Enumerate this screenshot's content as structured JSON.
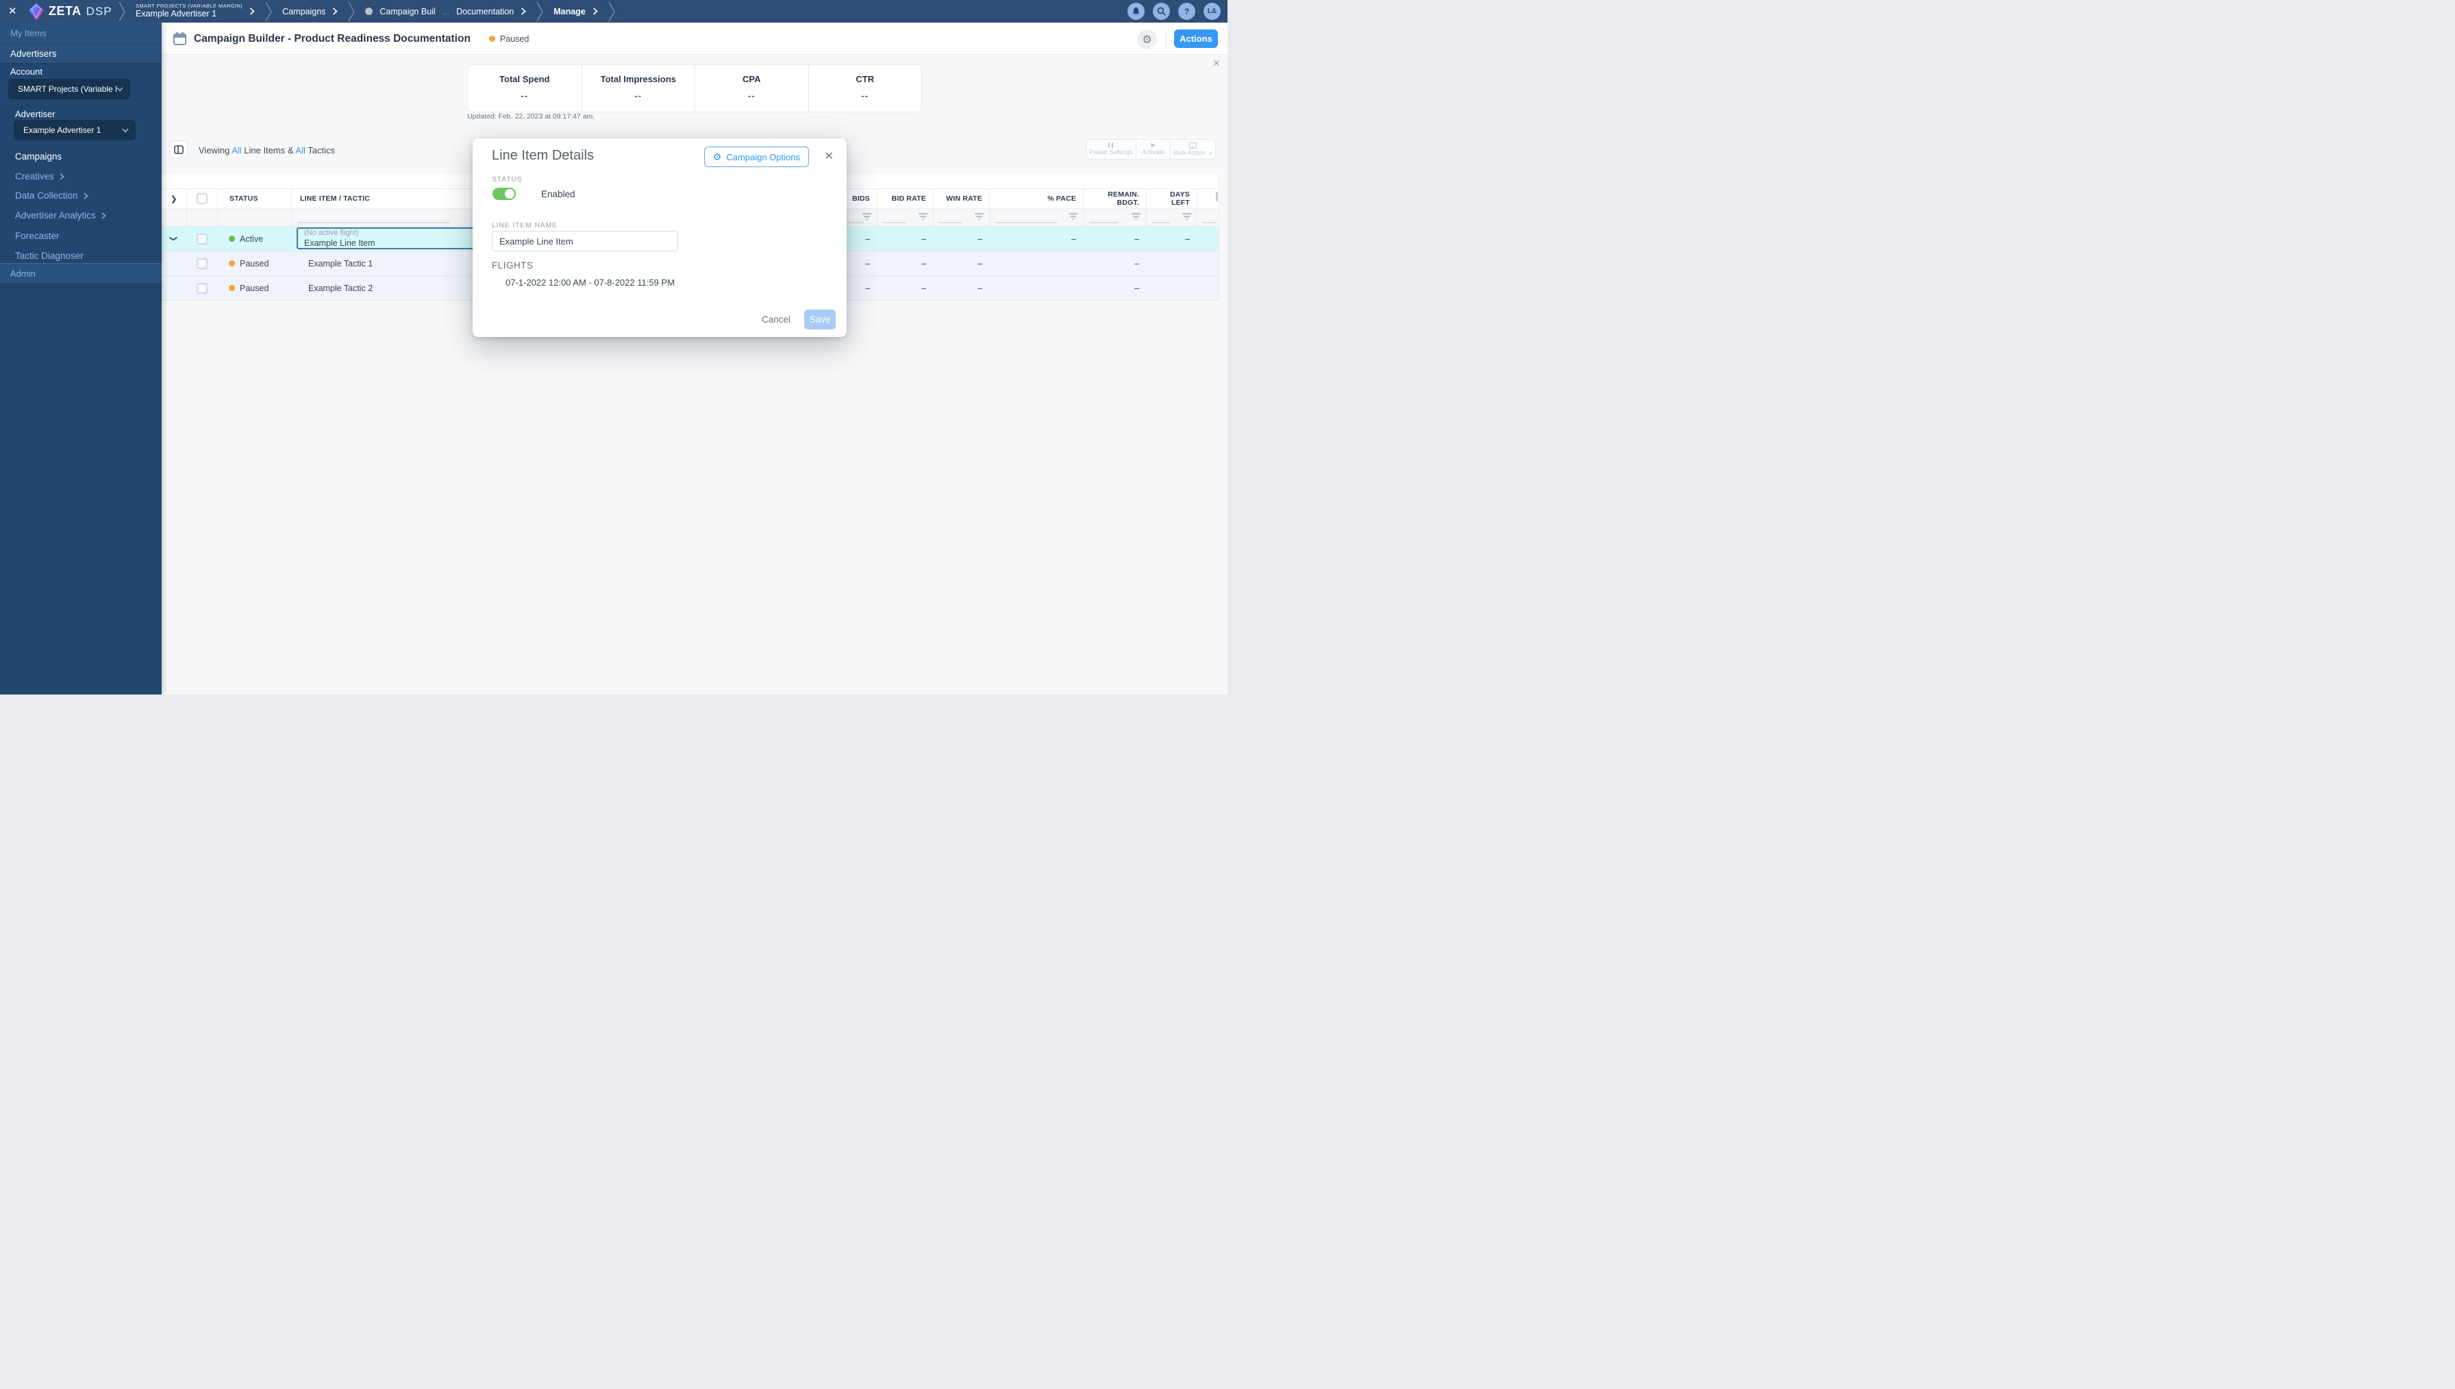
{
  "colors": {
    "accent": "#3598f4",
    "topbar_navy": "#2c4e77",
    "sidebar_navy": "#214770",
    "active_green": "#6abf54",
    "paused_orange": "#f2a33c",
    "toggle_green": "#6ec75f",
    "selected_row_cyan": "#d7f8f8"
  },
  "icons": {
    "close": "✕",
    "gear": "⚙",
    "chevron_right": "❯",
    "chevron_down": "∨",
    "question": "?"
  },
  "topbar": {
    "logo_zeta": "ZETA",
    "logo_dsp": "DSP",
    "breadcrumb": {
      "account_eyebrow": "SMART PROJECTS (VARIABLE MARGIN)",
      "account_label": "Example Advertiser 1",
      "campaigns": "Campaigns",
      "campaign_prefix": "Campaign Buil",
      "campaign_ellipsis": "...",
      "campaign_suffix": "Documentation",
      "manage": "Manage"
    },
    "avatar": "L&"
  },
  "sidebar": {
    "my_items": "My Items",
    "advertisers": "Advertisers",
    "account_label": "Account",
    "account_value": "SMART Projects (Variable M...",
    "advertiser_label": "Advertiser",
    "advertiser_value": "Example Advertiser 1",
    "items": [
      "Campaigns",
      "Creatives",
      "Data Collection",
      "Advertiser Analytics",
      "Forecaster",
      "Tactic Diagnoser"
    ],
    "admin": "Admin"
  },
  "page_header": {
    "title": "Campaign Builder - Product Readiness Documentation",
    "status": "Paused",
    "actions_label": "Actions"
  },
  "stats": {
    "metrics": [
      {
        "label": "Total Spend",
        "value": "--"
      },
      {
        "label": "Total Impressions",
        "value": "--"
      },
      {
        "label": "CPA",
        "value": "--"
      },
      {
        "label": "CTR",
        "value": "--"
      }
    ],
    "updated": "Updated: Feb. 22, 2023 at 09:17:47 am."
  },
  "toolbar": {
    "viewing_prefix": "Viewing ",
    "all_1": "All",
    "mid": " Line Items & ",
    "all_2": "All",
    "suffix": " Tactics",
    "pause_settings": "Pause Settings",
    "activate": "Activate",
    "bulk_action": "Bulk Action"
  },
  "table": {
    "columns": {
      "status": "STATUS",
      "line_item": "LINE ITEM / TACTIC",
      "bids": "BIDS",
      "bid_rate": "BID RATE",
      "win_rate": "WIN RATE",
      "pace": "% PACE",
      "remain": "REMAIN.\nBDGT.",
      "days": "DAYS\nLEFT"
    },
    "rows": [
      {
        "status": "Active",
        "subtext": "(No active flight)",
        "name": "Example Line Item",
        "bids": "–",
        "bid_rate": "–",
        "win_rate": "–",
        "pace": "–",
        "remain": "–",
        "days": "–"
      },
      {
        "status": "Paused",
        "name": "Example Tactic 1",
        "bids": "–",
        "bid_rate": "–",
        "win_rate": "–",
        "pace": "",
        "remain": "–",
        "days": ""
      },
      {
        "status": "Paused",
        "name": "Example Tactic 2",
        "bids": "–",
        "bid_rate": "–",
        "win_rate": "–",
        "pace": "",
        "remain": "–",
        "days": ""
      }
    ]
  },
  "modal": {
    "title": "Line Item Details",
    "campaign_options": "Campaign Options",
    "status_label": "STATUS",
    "status_value": "Enabled",
    "name_label": "LINE ITEM NAME",
    "name_value": "Example Line Item",
    "flights_label": "FLIGHTS",
    "flight_range": "07-1-2022 12:00 AM - 07-8-2022 11:59 PM",
    "cancel_label": "Cancel",
    "save_label": "Save"
  }
}
